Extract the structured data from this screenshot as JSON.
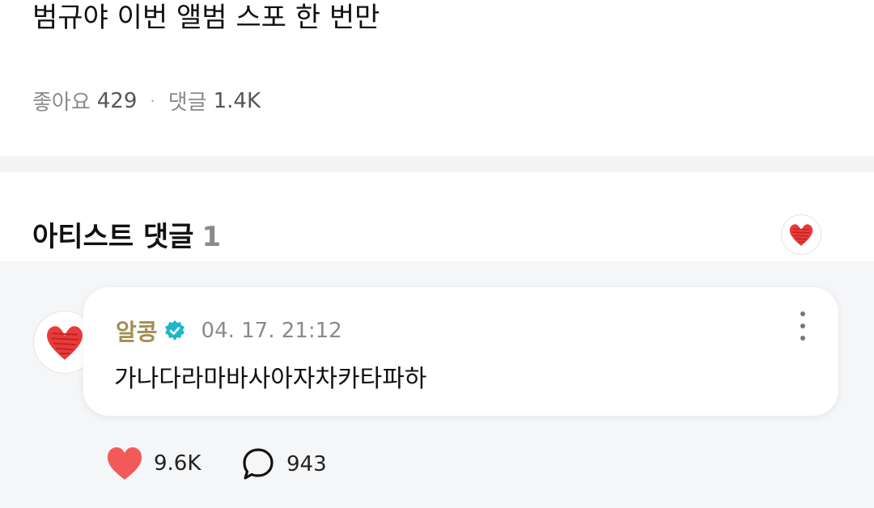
{
  "post": {
    "title": "범규야 이번 앨범 스포 한 번만",
    "likes_label": "좋아요",
    "likes_count": "429",
    "separator": "·",
    "comments_label": "댓글",
    "comments_count": "1.4K"
  },
  "artist_section": {
    "title": "아티스트 댓글",
    "count": "1",
    "avatar_icon": "heart-scribble-icon"
  },
  "comment": {
    "author": "알콩",
    "verified_icon": "verified-badge-icon",
    "timestamp": "04. 17. 21:12",
    "text": "가나다라마바사아자차카타파하",
    "likes": "9.6K",
    "replies": "943",
    "more_icon": "more-vertical-icon",
    "like_icon": "heart-icon",
    "reply_icon": "speech-bubble-icon"
  },
  "colors": {
    "author": "#a48e52",
    "verified": "#1fb6c9",
    "heart": "#f25a5a",
    "divider": "#f3f4f6",
    "comment_bg": "#f5f6f8"
  }
}
